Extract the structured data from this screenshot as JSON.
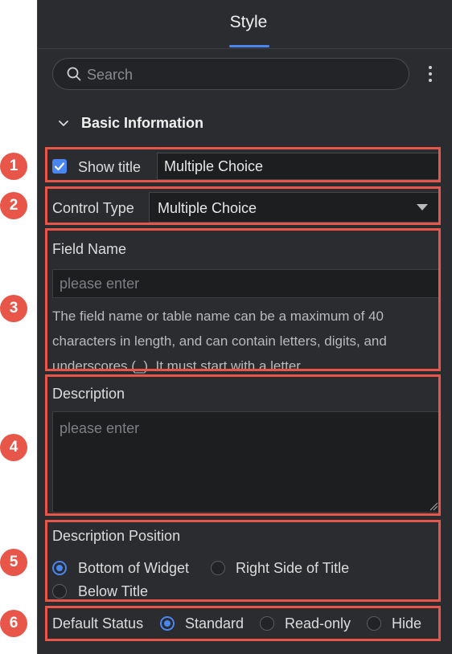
{
  "header": {
    "tab_label": "Style"
  },
  "search": {
    "placeholder": "Search"
  },
  "section": {
    "title": "Basic Information"
  },
  "show_title": {
    "label": "Show title",
    "checked": true,
    "value": "Multiple Choice"
  },
  "control_type": {
    "label": "Control Type",
    "value": "Multiple Choice"
  },
  "field_name": {
    "label": "Field Name",
    "placeholder": "please enter",
    "help": "The field name or table name can be a maximum of 40 characters in length, and can contain letters, digits, and underscores (_). It must start with a letter."
  },
  "description": {
    "label": "Description",
    "placeholder": "please enter"
  },
  "description_position": {
    "label": "Description Position",
    "options": [
      "Bottom of Widget",
      "Right Side of Title",
      "Below Title"
    ],
    "selected": "Bottom of Widget"
  },
  "default_status": {
    "label": "Default Status",
    "options": [
      "Standard",
      "Read-only",
      "Hide"
    ],
    "selected": "Standard"
  },
  "annotations": [
    "1",
    "2",
    "3",
    "4",
    "5",
    "6"
  ],
  "colors": {
    "accent": "#4a86f0",
    "annotation": "#e8564a",
    "panel": "#2b2c2f"
  }
}
